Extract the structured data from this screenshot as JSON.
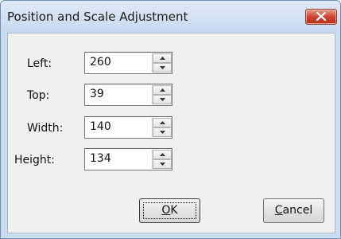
{
  "window": {
    "title": "Position and Scale Adjustment"
  },
  "fields": [
    {
      "label": "Left:",
      "value": "260"
    },
    {
      "label": "Top:",
      "value": "39"
    },
    {
      "label": "Width:",
      "value": "140"
    },
    {
      "label": "Height:",
      "value": "134"
    }
  ],
  "buttons": {
    "ok_mnemonic": "O",
    "ok_rest": "K",
    "cancel_mnemonic": "C",
    "cancel_rest": "ancel"
  },
  "icons": {
    "close": "close-x",
    "spin_up": "triangle-up",
    "spin_down": "triangle-down"
  },
  "colors": {
    "titlebar": "#c6d9ee",
    "close_button": "#c9402a",
    "client_background": "#f0f0f0"
  }
}
